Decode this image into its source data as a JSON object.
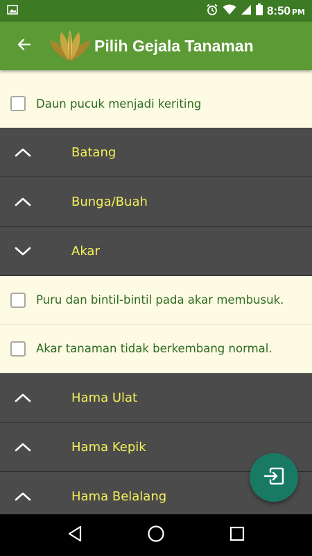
{
  "status_bar": {
    "time": "8:50",
    "ampm": "PM",
    "icons": [
      "image-icon",
      "alarm-icon",
      "wifi-icon",
      "signal-icon",
      "battery-icon"
    ]
  },
  "app_bar": {
    "title": "Pilih Gejala Tanaman",
    "back_icon": "arrow-back-icon",
    "logo": "tobacco-leaf-logo"
  },
  "list": {
    "daun_item": "Daun pucuk menjadi keriting",
    "sections": [
      {
        "label": "Batang",
        "state": "collapsed"
      },
      {
        "label": "Bunga/Buah",
        "state": "collapsed"
      },
      {
        "label": "Akar",
        "state": "expanded"
      },
      {
        "label": "Hama Ulat",
        "state": "collapsed"
      },
      {
        "label": "Hama Kepik",
        "state": "collapsed"
      },
      {
        "label": "Hama Belalang",
        "state": "collapsed"
      }
    ],
    "akar_items": [
      "Puru dan bintil-bintil pada akar membusuk.",
      "Akar tanaman tidak berkembang normal."
    ]
  },
  "fab": {
    "icon": "exit-to-app-icon"
  },
  "nav_bar": {
    "icons": [
      "back-triangle-icon",
      "home-circle-icon",
      "recents-square-icon"
    ]
  },
  "colors": {
    "status_bar": "#3d7a24",
    "app_bar": "#5c9a36",
    "section_header": "#4b4b4b",
    "section_label": "#f4f05a",
    "item_text": "#2f6b1f",
    "item_bg": "#fdfbe4",
    "fab": "#187a64"
  }
}
